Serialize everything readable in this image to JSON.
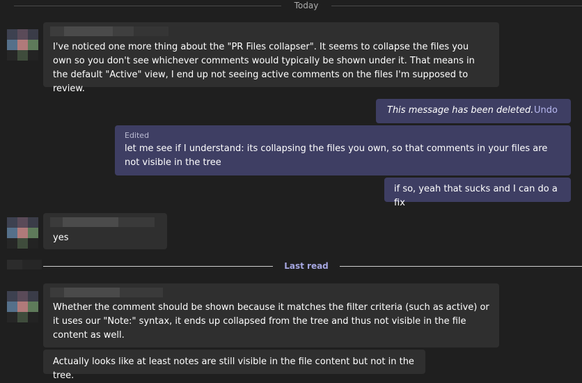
{
  "dividers": {
    "today": "Today",
    "last_read": "Last read"
  },
  "messages": {
    "m1": "I've noticed one more thing about the \"PR Files collapser\". It seems to collapse the files you own so you don't see whichever comments would typically be shown under it. That means in the default \"Active\" view, I end up not seeing active comments on the files I'm supposed to review.",
    "deleted_notice": "This message has been deleted.",
    "undo": "Undo",
    "edited_label": "Edited",
    "m2": "let me see if I understand: its collapsing the files you own, so that comments in your files are not visible in the tree",
    "m3": "if so, yeah that sucks and I can do a fix",
    "m4": "yes",
    "m5": "Whether the comment should be shown because it matches the filter criteria (such as active) or it uses our \"Note:\" syntax, it ends up collapsed from the tree and thus not visible in the file content as well.",
    "m6": "Actually looks like at least notes are still visible in the file content but not in the tree."
  },
  "colors": {
    "background": "#1f1f1f",
    "incoming_bubble": "#2f2f2f",
    "outgoing_bubble": "#3e3e63",
    "accent": "#a5a6e0"
  }
}
